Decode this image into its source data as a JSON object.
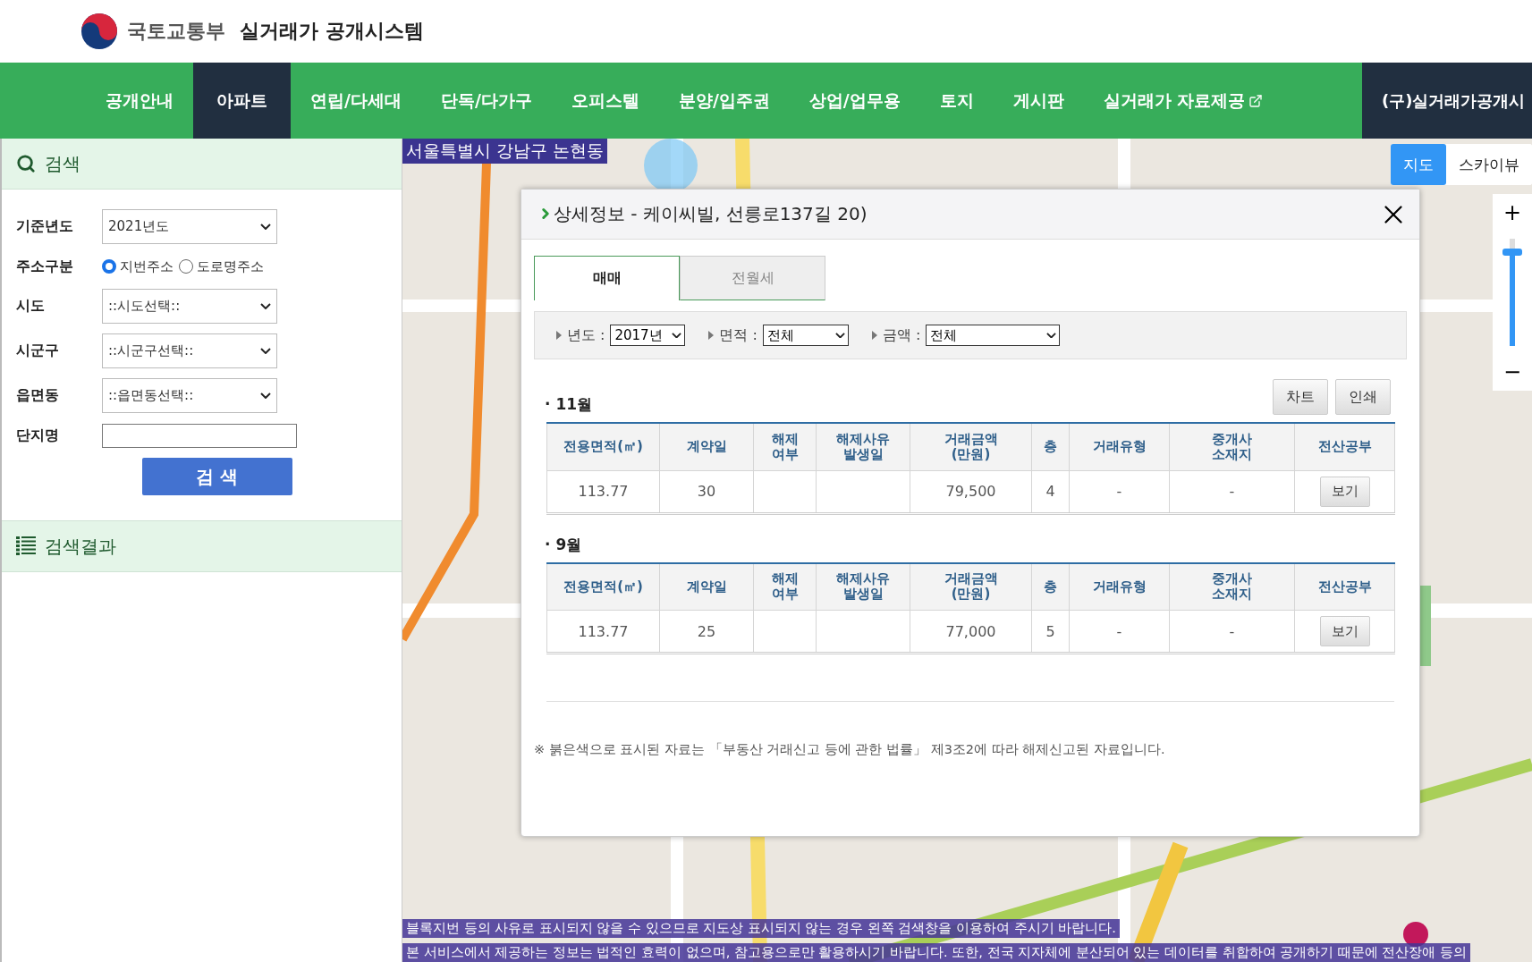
{
  "header": {
    "ministry": "국토교통부",
    "system": "실거래가 공개시스템"
  },
  "nav": [
    {
      "label": "공개안내",
      "selected": false,
      "kind": "link"
    },
    {
      "label": "아파트",
      "selected": true,
      "kind": "link"
    },
    {
      "label": "연립/다세대",
      "selected": false,
      "kind": "link"
    },
    {
      "label": "단독/다가구",
      "selected": false,
      "kind": "link"
    },
    {
      "label": "오피스텔",
      "selected": false,
      "kind": "link"
    },
    {
      "label": "분양/입주권",
      "selected": false,
      "kind": "link"
    },
    {
      "label": "상업/업무용",
      "selected": false,
      "kind": "link"
    },
    {
      "label": "토지",
      "selected": false,
      "kind": "link"
    },
    {
      "label": "게시판",
      "selected": false,
      "kind": "link"
    },
    {
      "label": "실거래가 자료제공",
      "selected": false,
      "kind": "external"
    },
    {
      "label": "(구)실거래가공개시",
      "kind": "legacy"
    }
  ],
  "sidebar": {
    "search_title": "검색",
    "fields": [
      {
        "label": "기준년도",
        "kind": "select",
        "value": "2021년도"
      },
      {
        "label": "주소구분",
        "kind": "radio",
        "options": [
          {
            "label": "지번주소",
            "selected": true
          },
          {
            "label": "도로명주소",
            "selected": false
          }
        ]
      },
      {
        "label": "시도",
        "kind": "select",
        "value": "::시도선택::"
      },
      {
        "label": "시군구",
        "kind": "select",
        "value": "::시군구선택::"
      },
      {
        "label": "읍면동",
        "kind": "select",
        "value": "::읍면동선택::"
      },
      {
        "label": "단지명",
        "kind": "text"
      }
    ],
    "search_button": "검 색",
    "results_title": "검색결과"
  },
  "map": {
    "location": "서울특별시 강남구 논현동",
    "map_types": [
      {
        "label": "지도",
        "selected": true
      },
      {
        "label": "스카이뷰",
        "selected": false
      }
    ],
    "zoom": {
      "plus": "+",
      "minus": "−",
      "level": 0.85
    },
    "notices": [
      "블록지번 등의 사유로 표시되지 않을 수 있으므로 지도상 표시되지 않는 경우 왼쪽 검색창을 이용하여 주시기 바랍니다.",
      "본 서비스에서 제공하는 정보는 법적인 효력이 없으며, 참고용으로만 활용하시기 바랍니다. 또한, 전국 지자체에 분산되어 있는 데이터를 취합하여 공개하기 때문에 전산장애 등의"
    ]
  },
  "detail": {
    "title": "상세정보 - 케이씨빌, 선릉로137길 20)",
    "tabs": [
      {
        "label": "매매",
        "selected": true
      },
      {
        "label": "전월세",
        "selected": false
      }
    ],
    "filters": [
      {
        "label": "년도 :",
        "value": "2017년"
      },
      {
        "label": "면적 :",
        "value": "전체"
      },
      {
        "label": "금액 :",
        "value": "전체"
      }
    ],
    "buttons": [
      "차트",
      "인쇄"
    ],
    "months": [
      {
        "month": "· 11월",
        "columns": [
          "전용면적(㎡)",
          "계약일",
          "해제\n여부",
          "해제사유\n발생일",
          "거래금액\n(만원)",
          "층",
          "거래유형",
          "중개사\n소재지",
          "전산공부"
        ],
        "rows": [
          {
            "cells": [
              "113.77",
              "30",
              "",
              "",
              "79,500",
              "4",
              "-",
              "-"
            ],
            "action": "보기"
          }
        ]
      },
      {
        "month": "· 9월",
        "columns": [
          "전용면적(㎡)",
          "계약일",
          "해제\n여부",
          "해제사유\n발생일",
          "거래금액\n(만원)",
          "층",
          "거래유형",
          "중개사\n소재지",
          "전산공부"
        ],
        "rows": [
          {
            "cells": [
              "113.77",
              "25",
              "",
              "",
              "77,000",
              "5",
              "-",
              "-"
            ],
            "action": "보기"
          }
        ]
      }
    ],
    "note": "※ 붉은색으로 표시된 자료는 「부동산 거래신고 등에 관한 법률」 제3조2에 따라 해제신고된 자료입니다."
  }
}
